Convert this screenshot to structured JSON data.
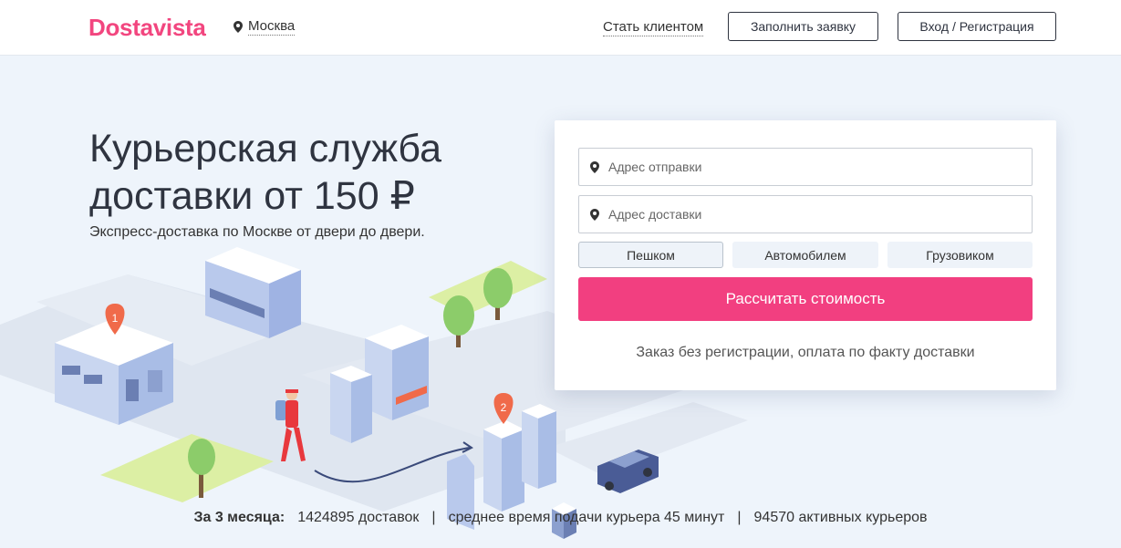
{
  "header": {
    "logo": "Dostavista",
    "city": "Москва",
    "become_client": "Стать клиентом",
    "request_button": "Заполнить заявку",
    "login_button": "Вход / Регистрация"
  },
  "hero": {
    "headline": "Курьерская служба доставки от 150 ₽",
    "subheadline": "Экспресс-доставка по Москве от двери до двери.",
    "markers": [
      "1",
      "2"
    ]
  },
  "order_form": {
    "from_placeholder": "Адрес отправки",
    "to_placeholder": "Адрес доставки",
    "transport": [
      {
        "label": "Пешком",
        "selected": true
      },
      {
        "label": "Автомобилем",
        "selected": false
      },
      {
        "label": "Грузовиком",
        "selected": false
      }
    ],
    "submit_label": "Рассчитать стоимость",
    "note": "Заказ без регистрации, оплата по факту доставки"
  },
  "stats": {
    "label": "За 3 месяца:",
    "deliveries": "1424895 доставок",
    "avg_time": "среднее время подачи курьера 45 минут",
    "couriers": "94570 активных курьеров",
    "separator": "|"
  },
  "colors": {
    "brand": "#f2467f",
    "accent_button": "#f23f80",
    "hero_bg": "#eef4fb",
    "text": "#2f3440"
  },
  "icons": [
    "map-pin-icon"
  ]
}
